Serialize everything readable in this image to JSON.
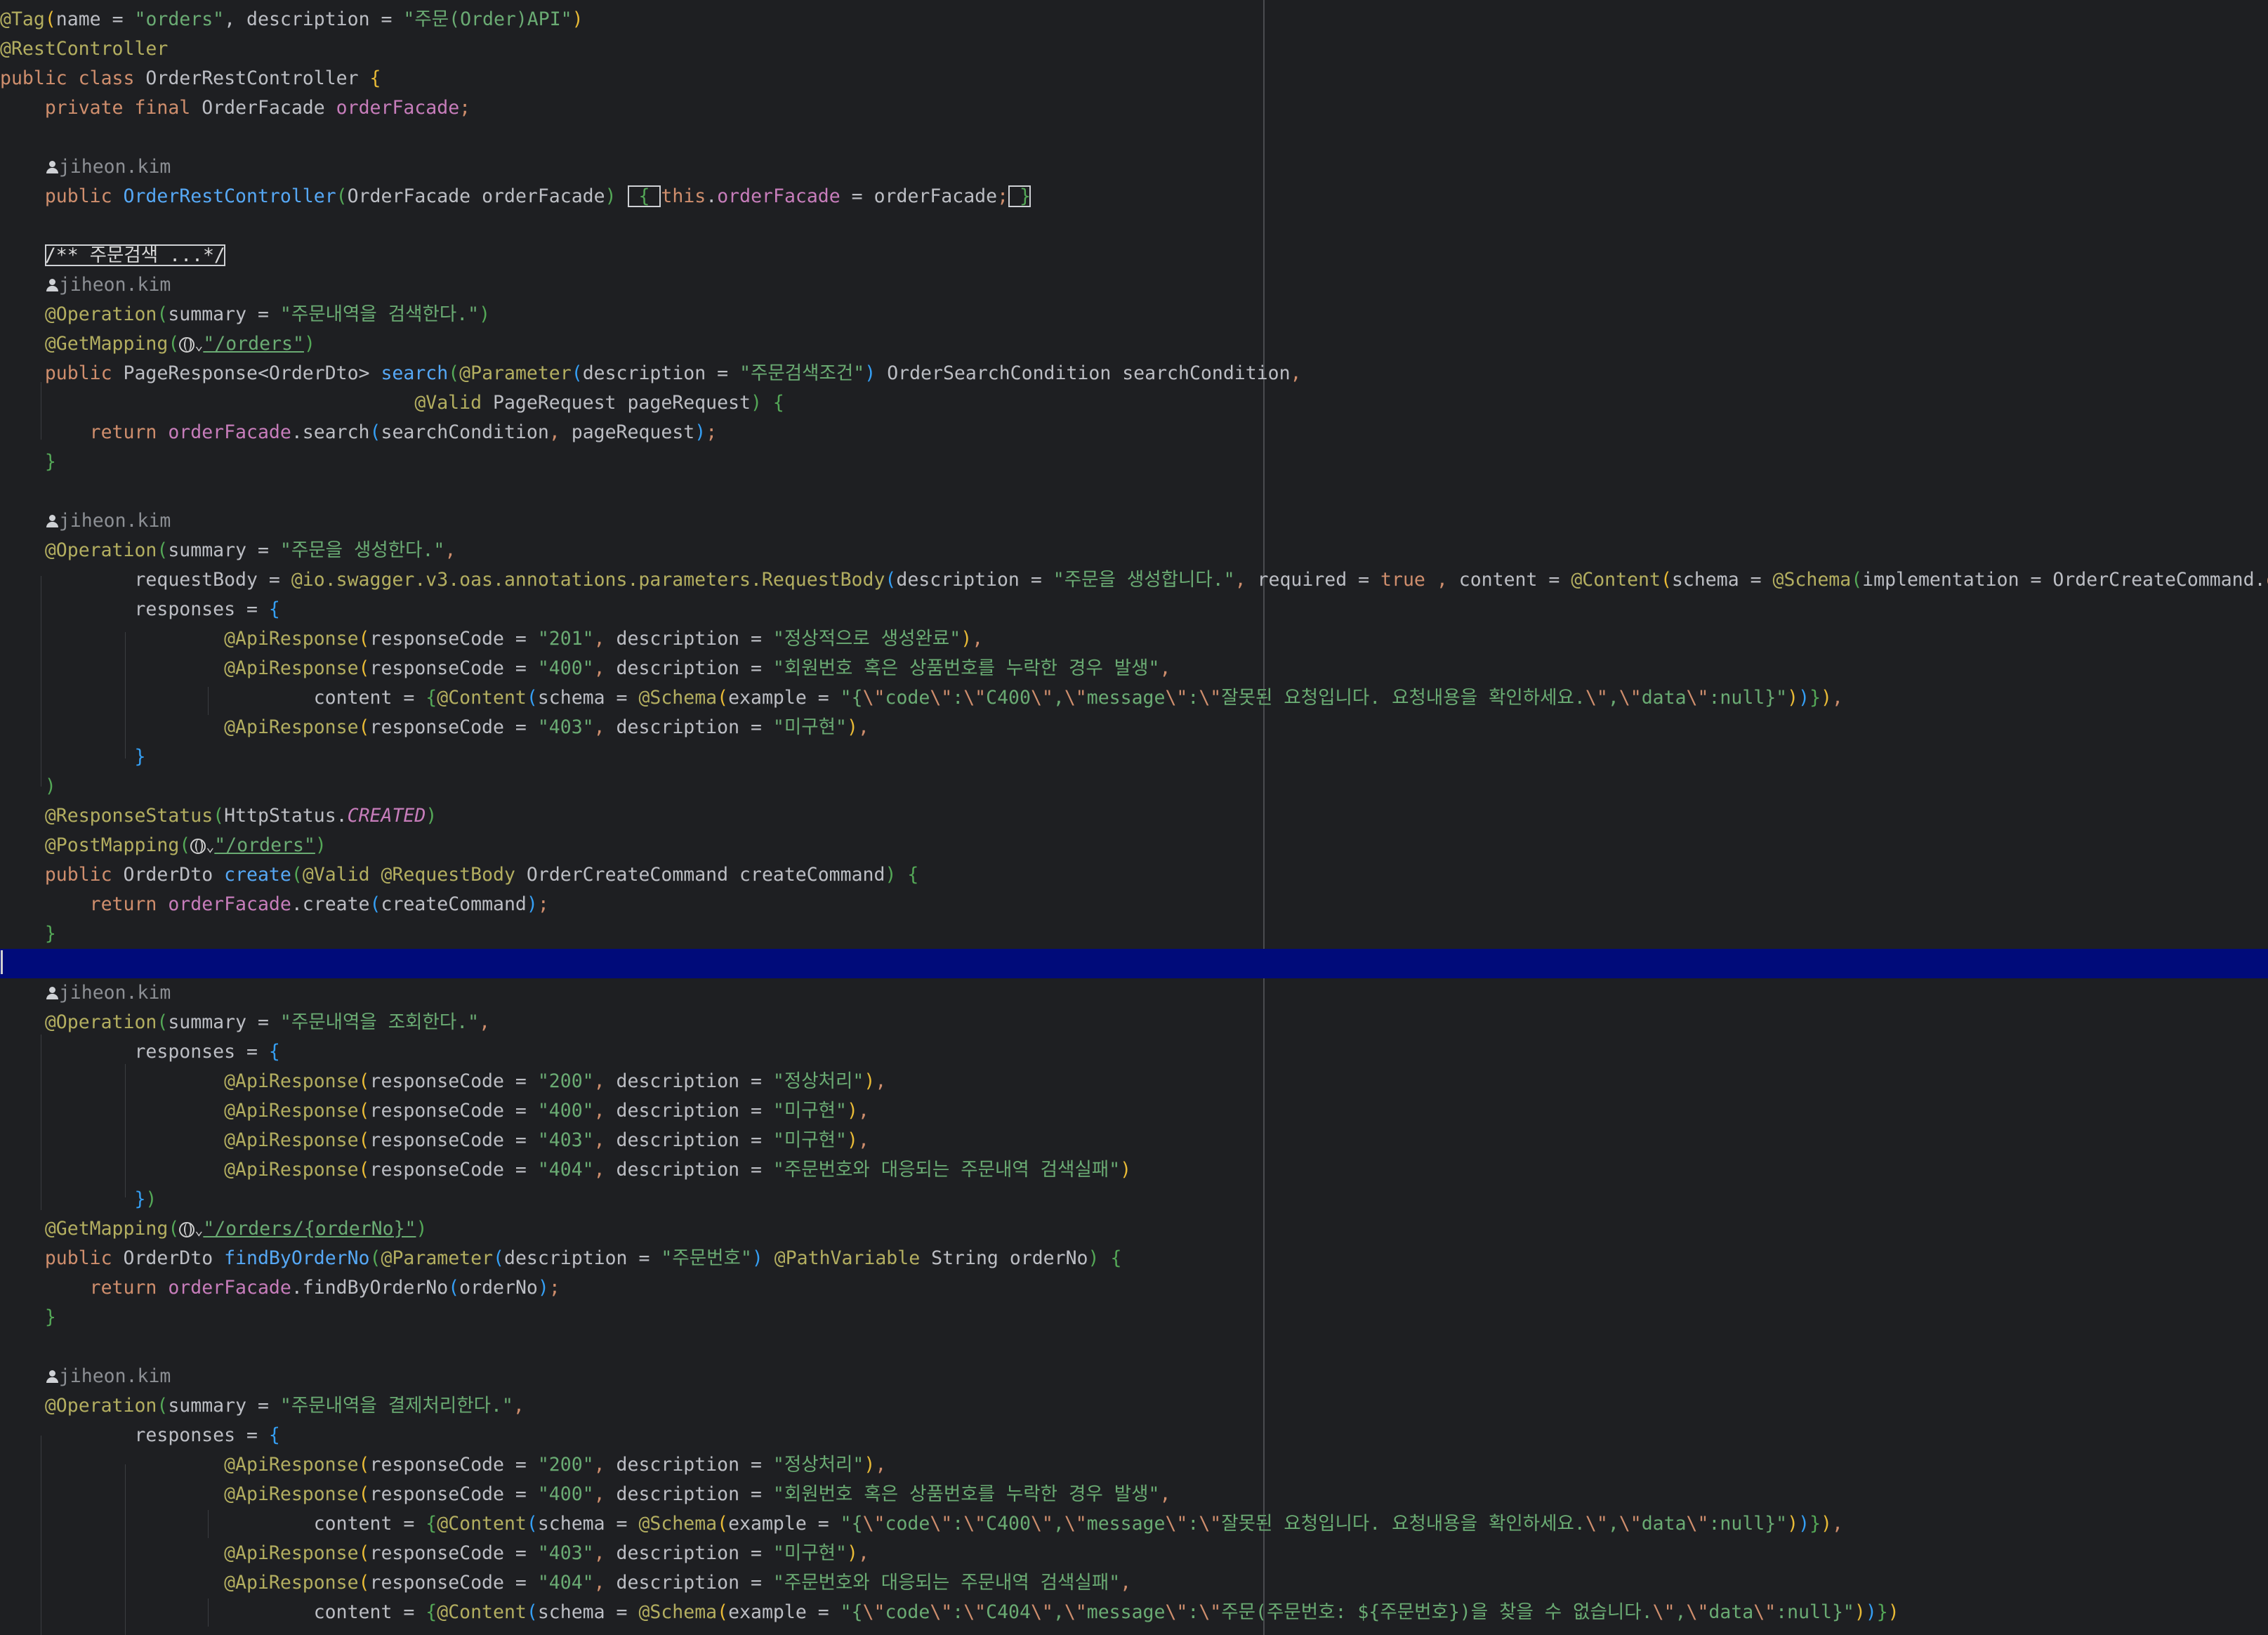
{
  "author": "jiheon.kim",
  "tag": {
    "name": "\"orders\"",
    "description": "\"주문(Order)API\""
  },
  "class_name": "OrderRestController",
  "facade_type": "OrderFacade",
  "facade_field": "orderFacade",
  "folded_comment": "/** 주문검색 ...*/",
  "search": {
    "summary": "\"주문내역을 검색한다.\"",
    "path": "\"/orders\"",
    "param_description": "\"주문검색조건\""
  },
  "create": {
    "summary": "\"주문을 생성한다.\"",
    "request_body_description": "\"주문을 생성합니다.\"",
    "responses": [
      {
        "code": "\"201\"",
        "description": "\"정상적으로 생성완료\""
      },
      {
        "code": "\"400\"",
        "description": "\"회원번호 혹은 상품번호를 누락한 경우 발생\""
      },
      {
        "code": "\"403\"",
        "description": "\"미구현\""
      }
    ],
    "example_400_a": "\"{",
    "example_400_msg": "잘못된 요청입니다. 요청내용을 확인하세요.",
    "path": "\"/orders\""
  },
  "find": {
    "summary": "\"주문내역을 조회한다.\"",
    "responses": [
      {
        "code": "\"200\"",
        "description": "\"정상처리\""
      },
      {
        "code": "\"400\"",
        "description": "\"미구현\""
      },
      {
        "code": "\"403\"",
        "description": "\"미구현\""
      },
      {
        "code": "\"404\"",
        "description": "\"주문번호와 대응되는 주문내역 검색실패\""
      }
    ],
    "path": "\"/orders/{orderNo}\"",
    "param_description": "\"주문번호\""
  },
  "pay": {
    "summary": "\"주문내역을 결제처리한다.\"",
    "responses": [
      {
        "code": "\"200\"",
        "description": "\"정상처리\""
      },
      {
        "code": "\"400\"",
        "description": "\"회원번호 혹은 상품번호를 누락한 경우 발생\""
      },
      {
        "code": "\"403\"",
        "description": "\"미구현\""
      },
      {
        "code": "\"404\"",
        "description": "\"주문번호와 대응되는 주문내역 검색실패\""
      }
    ],
    "example_404_msg": "주문(주문번호: ${주문번호})을 찾을 수 없습니다."
  }
}
